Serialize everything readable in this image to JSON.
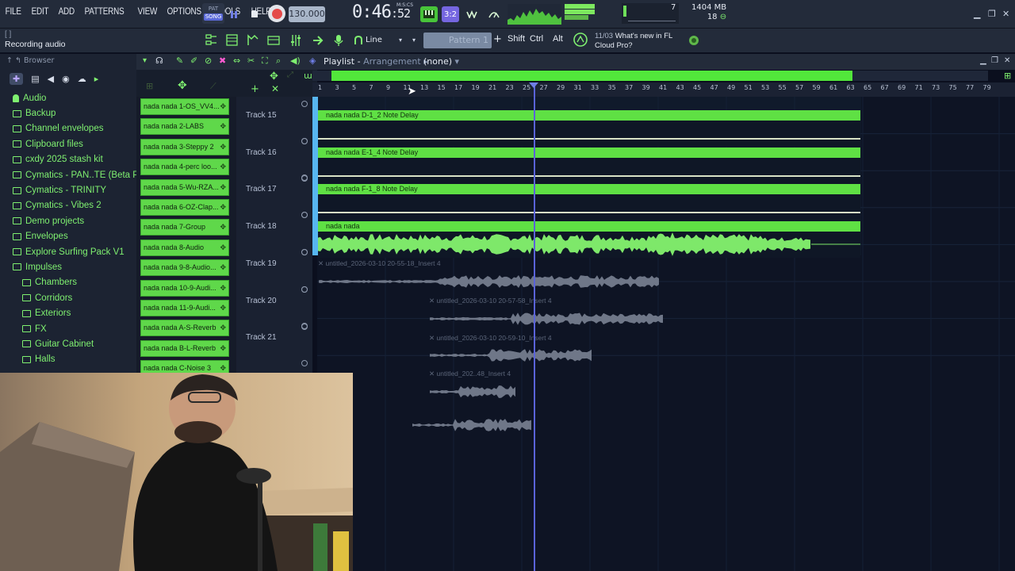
{
  "menu": [
    "FILE",
    "EDIT",
    "ADD",
    "PATTERNS",
    "VIEW",
    "OPTIONS",
    "TOOLS",
    "HELP"
  ],
  "transport": {
    "pat_label": "PAT",
    "song_label": "SONG",
    "tempo": "130.000",
    "time_main": "0:46",
    "time_sub": ":52",
    "time_unit": "M:S:CS",
    "cpu_num": "7",
    "mem": "1404 MB",
    "polyphony": "18"
  },
  "hint": {
    "title": "[ ]",
    "text": "Recording audio"
  },
  "toolbar2": {
    "snap": "Line",
    "pattern": "Pattern 1",
    "shift": "Shift",
    "ctrl": "Ctrl",
    "alt": "Alt"
  },
  "news": {
    "date": "11/03",
    "line1": "What's new in FL",
    "line2": "Cloud Pro?"
  },
  "browser": {
    "title": "Browser",
    "items": [
      {
        "label": "Audio",
        "level": "top"
      },
      {
        "label": "Backup",
        "level": "top"
      },
      {
        "label": "Channel envelopes",
        "level": "top"
      },
      {
        "label": "Clipboard files",
        "level": "top"
      },
      {
        "label": "cxdy 2025 stash kit",
        "level": "top"
      },
      {
        "label": "Cymatics - PAN..TE (Beta Pack)",
        "level": "top"
      },
      {
        "label": "Cymatics - TRINITY",
        "level": "top"
      },
      {
        "label": "Cymatics - Vibes 2",
        "level": "top"
      },
      {
        "label": "Demo projects",
        "level": "top"
      },
      {
        "label": "Envelopes",
        "level": "top"
      },
      {
        "label": "Explore Surfing Pack V1",
        "level": "top"
      },
      {
        "label": "Impulses",
        "level": "top"
      },
      {
        "label": "Chambers",
        "level": "sub"
      },
      {
        "label": "Corridors",
        "level": "sub"
      },
      {
        "label": "Exteriors",
        "level": "sub"
      },
      {
        "label": "FX",
        "level": "sub"
      },
      {
        "label": "Guitar Cabinet",
        "level": "sub"
      },
      {
        "label": "Halls",
        "level": "sub"
      }
    ]
  },
  "channels": [
    "nada nada 1-OS_VV4...",
    "nada nada 2-LABS",
    "nada nada 3-Steppy 2",
    "nada nada 4-perc loo...",
    "nada nada 5-Wu-RZA...",
    "nada nada 6-OZ-Clap...",
    "nada nada 7-Group",
    "nada nada 8-Audio",
    "nada nada 9-8-Audio...",
    "nada nada 10-9-Audi...",
    "nada nada 11-9-Audi...",
    "nada nada A-S-Reverb",
    "nada nada B-L-Reverb",
    "nada nada C-Noise 3"
  ],
  "playlist": {
    "title": "Playlist",
    "subtitle": "Arrangement",
    "pattern": "(none)",
    "ruler": [
      "1",
      "3",
      "5",
      "7",
      "9",
      "11",
      "13",
      "15",
      "17",
      "19",
      "21",
      "23",
      "25",
      "27",
      "29",
      "31",
      "33",
      "35",
      "37",
      "39",
      "41",
      "43",
      "45",
      "47",
      "49",
      "51",
      "53",
      "55",
      "57",
      "59",
      "61",
      "63",
      "65",
      "67",
      "69",
      "71",
      "73",
      "75",
      "77",
      "79"
    ],
    "tracks": [
      "Track 15",
      "Track 16",
      "Track 17",
      "Track 18",
      "Track 19",
      "Track 20",
      "Track 21"
    ],
    "clips": [
      {
        "label": "nada nada D-1_2 Note Delay"
      },
      {
        "label": "nada nada E-1_4 Note Delay"
      },
      {
        "label": "nada nada F-1_8 Note Delay"
      },
      {
        "label": "nada nada"
      }
    ],
    "ghost_clips": [
      {
        "label": "untitled_2026-03-10 20-55-18_Insert 4"
      },
      {
        "label": "untitled_2026-03-10 20-57-58_Insert 4"
      },
      {
        "label": "untitled_2026-03-10 20-59-10_Insert 4"
      },
      {
        "label": "untitled_202..48_Insert 4"
      }
    ]
  }
}
